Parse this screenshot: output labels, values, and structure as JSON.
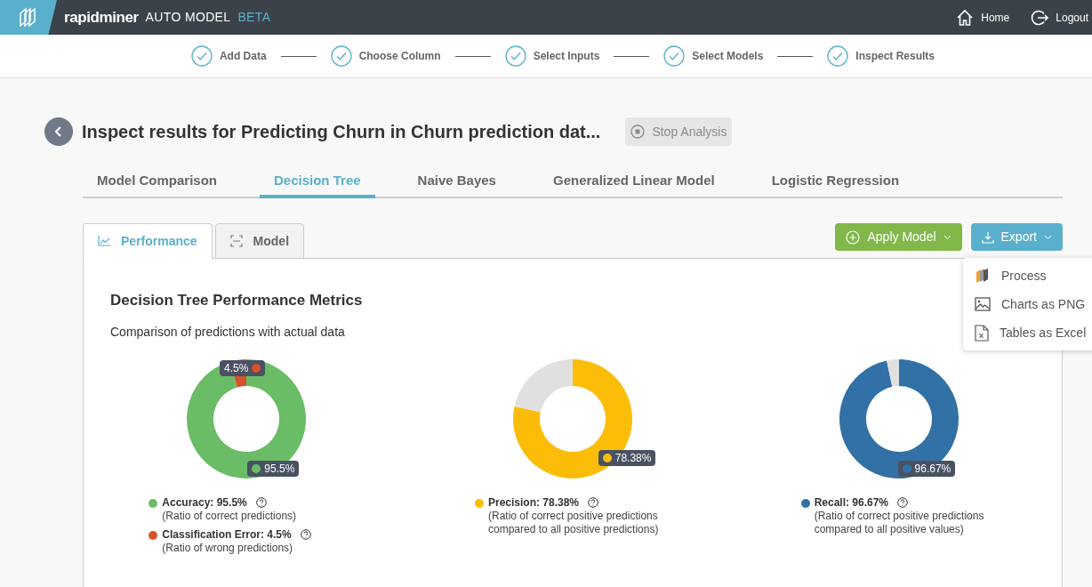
{
  "header": {
    "brand": "rapidminer",
    "product": "AUTO MODEL",
    "badge": "BETA",
    "nav": [
      {
        "label": "Home",
        "kind": "home"
      },
      {
        "label": "Logout",
        "kind": "logout"
      }
    ]
  },
  "steps": [
    {
      "label": "Add Data",
      "done": true
    },
    {
      "label": "Choose Column",
      "done": true
    },
    {
      "label": "Select Inputs",
      "done": true
    },
    {
      "label": "Select Models",
      "done": true
    },
    {
      "label": "Inspect Results",
      "done": true
    }
  ],
  "title": "Inspect results for Predicting Churn in Churn prediction dat...",
  "stop_button": {
    "label": "Stop Analysis",
    "disabled": true
  },
  "model_tabs": [
    {
      "label": "Model Comparison",
      "selected": false
    },
    {
      "label": "Decision Tree",
      "selected": true
    },
    {
      "label": "Naive Bayes",
      "selected": false
    },
    {
      "label": "Generalized Linear Model",
      "selected": false
    },
    {
      "label": "Logistic Regression",
      "selected": false
    }
  ],
  "view_tabs": [
    {
      "label": "Performance",
      "kind": "chart",
      "selected": true
    },
    {
      "label": "Model",
      "kind": "model",
      "selected": false
    }
  ],
  "apply_button": "Apply Model",
  "export_button": "Export",
  "export_menu": [
    {
      "label": "Process",
      "kind": "process"
    },
    {
      "label": "Charts as PNG",
      "kind": "image"
    },
    {
      "label": "Tables as Excel",
      "kind": "excel"
    }
  ],
  "panel": {
    "heading": "Decision Tree Performance Metrics",
    "subheading": "Comparison of predictions with actual data",
    "metrics": [
      {
        "chart_data": {
          "type": "donut",
          "values": [
            95.5,
            4.5
          ],
          "colors": [
            "#6abd66",
            "#d6532e"
          ],
          "value_labels": [
            "95.5%",
            "4.5%"
          ]
        },
        "legend": [
          {
            "label": "Accuracy: 95.5%",
            "description": "(Ratio of correct predictions)",
            "color": "#6abd66"
          },
          {
            "label": "Classification Error: 4.5%",
            "description": "(Ratio of wrong predictions)",
            "color": "#d6532e"
          }
        ]
      },
      {
        "chart_data": {
          "type": "donut",
          "values": [
            78.38,
            21.62
          ],
          "colors": [
            "#fbbd08",
            "#e0e0e0"
          ],
          "value_labels": [
            "78.38%",
            null
          ]
        },
        "legend": [
          {
            "label": "Precision: 78.38%",
            "description": "(Ratio of correct positive predictions compared to all positive predictions)",
            "color": "#fbbd08"
          }
        ]
      },
      {
        "chart_data": {
          "type": "donut",
          "values": [
            96.67,
            3.33
          ],
          "colors": [
            "#3171a5",
            "#e0e0e0"
          ],
          "value_labels": [
            "96.67%",
            null
          ]
        },
        "legend": [
          {
            "label": "Recall: 96.67%",
            "description": "(Ratio of correct positive predictions compared to all positive values)",
            "color": "#3171a5"
          }
        ]
      }
    ]
  }
}
